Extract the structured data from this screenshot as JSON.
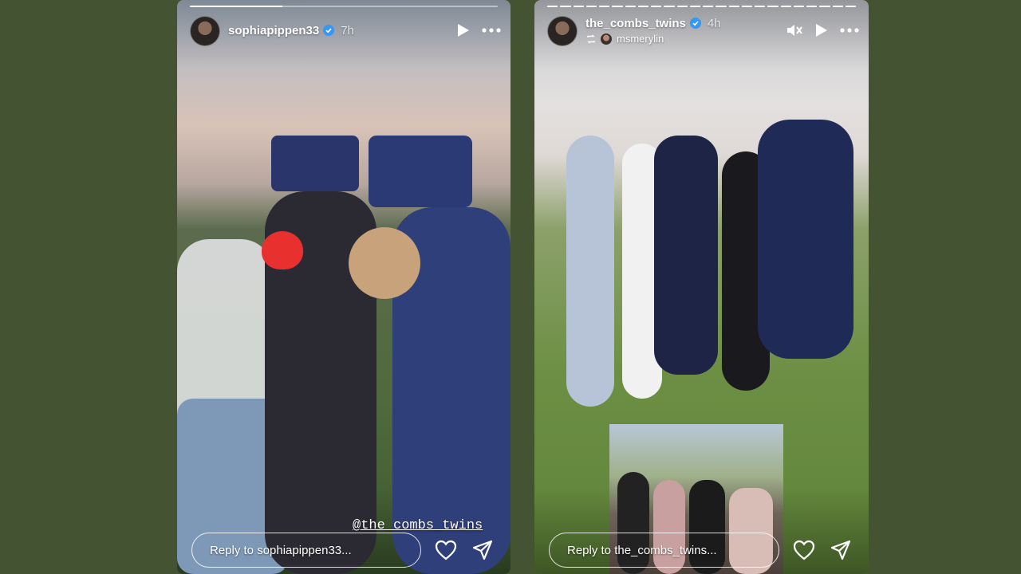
{
  "stories": [
    {
      "username": "sophiapippen33",
      "time": "7h",
      "progress": [
        0.3
      ],
      "mention": "@the_combs_twins",
      "reply_placeholder": "Reply to sophiapippen33..."
    },
    {
      "username": "the_combs_twins",
      "time": "4h",
      "reposted_from": "msmerylin",
      "progress": [
        1,
        1,
        1,
        1,
        1,
        1,
        1,
        1,
        1,
        1,
        1,
        1,
        1,
        1,
        1,
        1,
        1,
        1,
        1,
        1,
        1,
        1,
        1,
        1
      ],
      "reply_placeholder": "Reply to the_combs_twins..."
    }
  ],
  "colors": {
    "background": "#445432",
    "verified": "#3897f0",
    "heart_sticker": "#e8312f"
  },
  "icons": [
    "verified-badge-icon",
    "play-icon",
    "more-icon",
    "mute-icon",
    "repost-icon",
    "heart-icon",
    "send-icon"
  ]
}
